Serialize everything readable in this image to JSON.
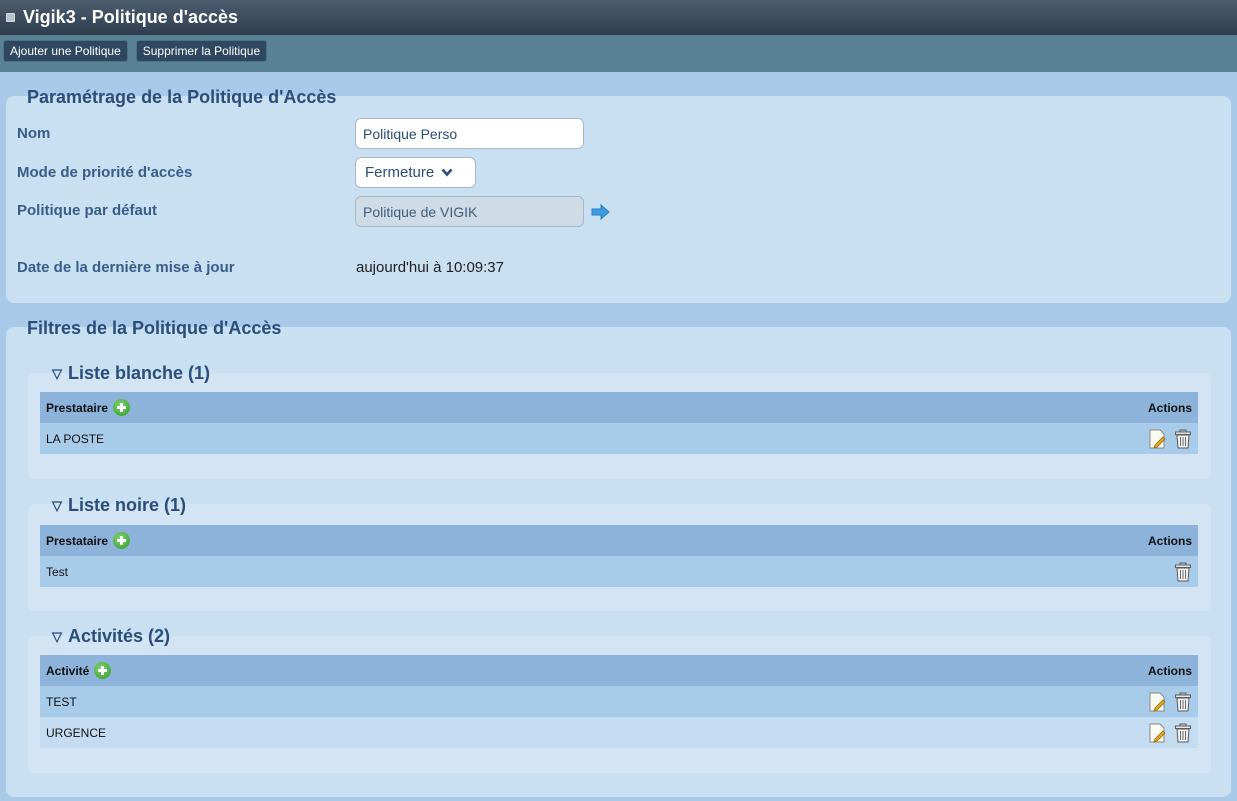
{
  "window": {
    "title": "Vigik3 - Politique d'accès"
  },
  "toolbar": {
    "add_label": "Ajouter une Politique",
    "delete_label": "Supprimer la Politique"
  },
  "settings": {
    "title": "Paramétrage de la Politique d'Accès",
    "name_label": "Nom",
    "name_value": "Politique Perso",
    "priority_label": "Mode de priorité d'accès",
    "priority_value": "Fermeture",
    "default_label": "Politique par défaut",
    "default_value": "Politique de VIGIK",
    "updated_label": "Date de la dernière mise à jour",
    "updated_value": "aujourd'hui à 10:09:37"
  },
  "filters": {
    "title": "Filtres de la Politique d'Accès",
    "whitelist": {
      "title": "Liste blanche (1)",
      "col": "Prestataire",
      "actions": "Actions",
      "rows": [
        {
          "label": "LA POSTE"
        }
      ]
    },
    "blacklist": {
      "title": "Liste noire (1)",
      "col": "Prestataire",
      "actions": "Actions",
      "rows": [
        {
          "label": "Test"
        }
      ]
    },
    "activities": {
      "title": "Activités (2)",
      "col": "Activité",
      "actions": "Actions",
      "rows": [
        {
          "label": "TEST"
        },
        {
          "label": "URGENCE"
        }
      ]
    }
  },
  "icons": {
    "window": "window-icon",
    "add": "add-circle-icon",
    "edit": "edit-icon",
    "delete": "trash-icon",
    "goto": "arrow-right-icon",
    "collapse": "triangle-down-icon"
  }
}
